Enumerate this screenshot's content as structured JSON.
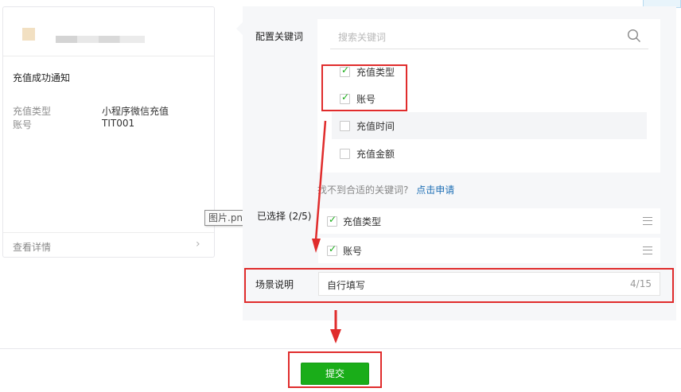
{
  "preview": {
    "title": "充值成功通知",
    "fields": [
      {
        "label": "充值类型",
        "value": "小程序微信充值"
      },
      {
        "label": "账号",
        "value": "TIT001"
      }
    ],
    "footer": "查看详情",
    "chevron": "›"
  },
  "tooltip": "图片.png",
  "config": {
    "keyword_label": "配置关键词",
    "search_placeholder": "搜索关键词",
    "keywords": [
      {
        "label": "充值类型",
        "checked": true
      },
      {
        "label": "账号",
        "checked": true
      },
      {
        "label": "充值时间",
        "checked": false
      },
      {
        "label": "充值金额",
        "checked": false
      }
    ],
    "help_text": "找不到合适的关键词?",
    "help_link": "点击申请",
    "selected_label": "已选择 (2/5)",
    "selected": [
      "充值类型",
      "账号"
    ],
    "scene_label": "场景说明",
    "scene_value": "自行填写",
    "scene_count": "4/15"
  },
  "submit_label": "提交",
  "colors": {
    "accent": "#1aad19",
    "annotation": "#e02c2c",
    "link": "#1e6fb5"
  }
}
